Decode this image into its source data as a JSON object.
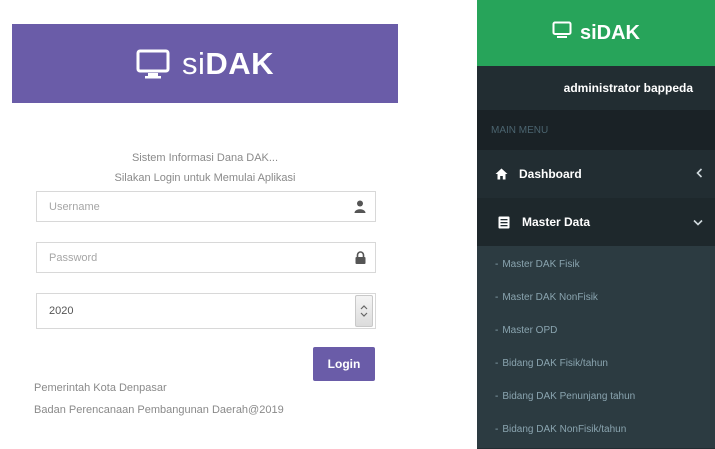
{
  "login": {
    "brand_prefix": "si",
    "brand_bold": "DAK",
    "intro_line1": "Sistem Informasi Dana DAK...",
    "intro_line2": "Silakan Login untuk Memulai Aplikasi",
    "username_placeholder": "Username",
    "password_placeholder": "Password",
    "year_value": "2020",
    "login_button": "Login",
    "footer_line1": "Pemerintah Kota Denpasar",
    "footer_line2": "Badan Perencanaan Pembangunan Daerah@2019",
    "colors": {
      "header": "#6a5ca8",
      "button": "#6a5ca8"
    }
  },
  "sidebar": {
    "brand": "siDAK",
    "user": "administrator bappeda",
    "section_label": "MAIN MENU",
    "items": [
      {
        "label": "Dashboard",
        "icon": "dashboard-icon",
        "chevron": "chevron-left-icon"
      },
      {
        "label": "Master Data",
        "icon": "database-icon",
        "chevron": "chevron-down-icon"
      }
    ],
    "sub_items": [
      "Master DAK Fisik",
      "Master DAK NonFisik",
      "Master OPD",
      "Bidang DAK Fisik/tahun",
      "Bidang DAK Penunjang tahun",
      "Bidang DAK NonFisik/tahun"
    ],
    "colors": {
      "header": "#27a45a",
      "background": "#222d32"
    }
  }
}
